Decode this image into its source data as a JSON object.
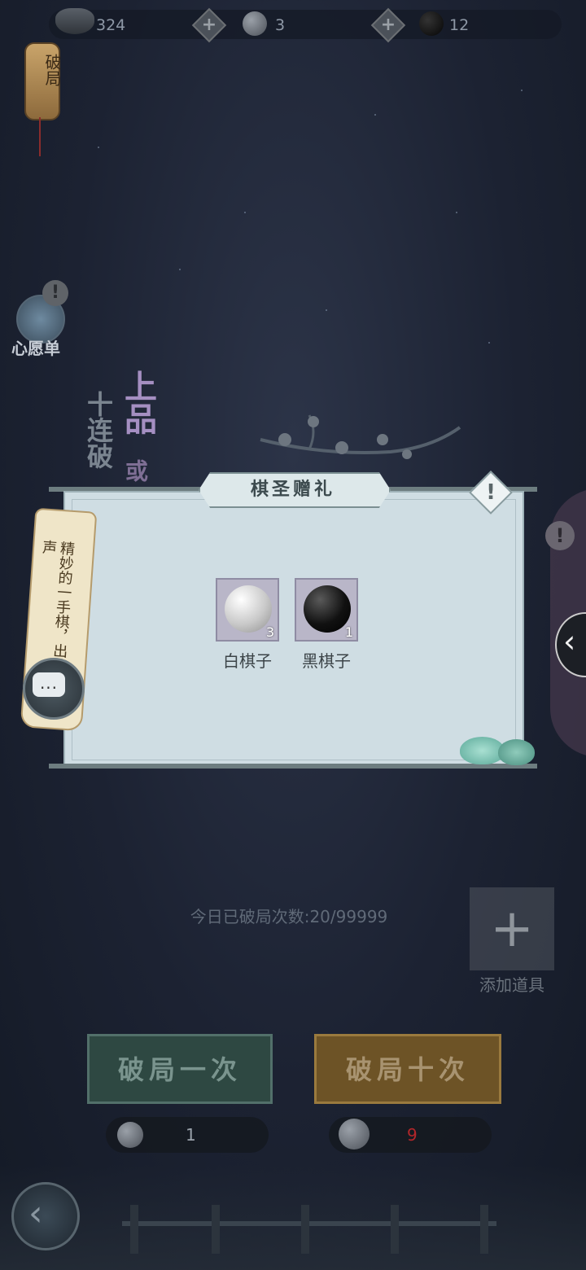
{
  "currency": {
    "coins": "324",
    "white_stones": "3",
    "black_stones": "12"
  },
  "lantern_label": "破局",
  "wishlist_label": "心愿单",
  "decor": {
    "tag1": "上品",
    "tag2": "十连破",
    "tag3": "或"
  },
  "tag_scroll_text": "精妙的一手棋，出惊叹之声",
  "modal": {
    "title": "棋圣赠礼",
    "help_symbol": "!",
    "items": [
      {
        "name": "白棋子",
        "count": "3",
        "color": "#e6e6e6"
      },
      {
        "name": "黑棋子",
        "count": "1",
        "color": "#111111"
      }
    ]
  },
  "side": {
    "alert_symbol": "!",
    "arrow_symbol": "‹"
  },
  "wish_alert_symbol": "!",
  "chat_symbol": "...",
  "daily_count": "今日已破局次数:20/99999",
  "add_item": {
    "plus": "+",
    "label": "添加道具"
  },
  "buttons": {
    "once": "破局一次",
    "ten": "破局十次"
  },
  "costs": {
    "once": "1",
    "ten": "9"
  },
  "colors": {
    "cost_once": "#9aa2ab",
    "cost_ten": "#b3262a"
  },
  "back_symbol": "‹"
}
